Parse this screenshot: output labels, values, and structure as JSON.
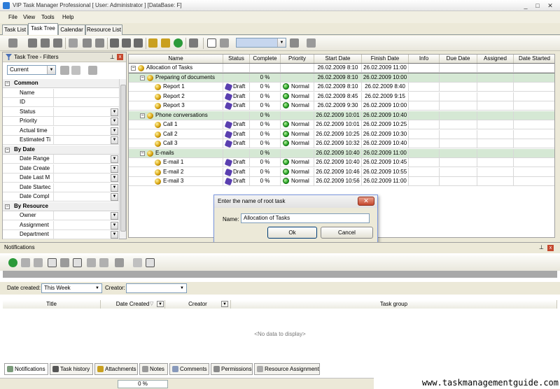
{
  "window": {
    "title": "VIP Task Manager Professional [ User: Administrator ] [DataBase: F]"
  },
  "menu": {
    "items": [
      {
        "label": "File"
      },
      {
        "label": "View"
      },
      {
        "label": "Tools"
      },
      {
        "label": "Help"
      }
    ]
  },
  "tabs": [
    {
      "label": "Task List"
    },
    {
      "label": "Task Tree"
    },
    {
      "label": "Calendar"
    },
    {
      "label": "Resource List"
    }
  ],
  "filter_panel": {
    "title": "Task Tree - Filters",
    "view_select": "Current",
    "categories": [
      {
        "label": "Common",
        "rows": [
          {
            "label": "Name",
            "has_dropdown": false
          },
          {
            "label": "ID",
            "has_dropdown": false
          },
          {
            "label": "Status",
            "has_dropdown": true
          },
          {
            "label": "Priority",
            "has_dropdown": true
          },
          {
            "label": "Actual time",
            "has_dropdown": true
          },
          {
            "label": "Estimated Ti",
            "has_dropdown": true
          }
        ]
      },
      {
        "label": "By Date",
        "rows": [
          {
            "label": "Date Range",
            "has_dropdown": true
          },
          {
            "label": "Date Create",
            "has_dropdown": true
          },
          {
            "label": "Date Last M",
            "has_dropdown": true
          },
          {
            "label": "Date Startec",
            "has_dropdown": true
          },
          {
            "label": "Date Compl",
            "has_dropdown": true
          }
        ]
      },
      {
        "label": "By Resource",
        "rows": [
          {
            "label": "Owner",
            "has_dropdown": true
          },
          {
            "label": "Assignment",
            "has_dropdown": true
          },
          {
            "label": "Department",
            "has_dropdown": true
          }
        ]
      }
    ]
  },
  "grid": {
    "columns": [
      "Name",
      "Status",
      "Complete",
      "Priority",
      "Start Date",
      "Finish Date",
      "Info",
      "Due Date",
      "Assigned",
      "Date Started"
    ],
    "rows": [
      {
        "level": 0,
        "group": true,
        "selected": true,
        "name": "Allocation of Tasks",
        "status": "",
        "complete": "",
        "priority": "",
        "start": "26.02.2009 8:10",
        "finish": "26.02.2009 11:00"
      },
      {
        "level": 1,
        "group": true,
        "name": "Preparing of documents",
        "status": "",
        "complete": "0 %",
        "priority": "",
        "start": "26.02.2009 8:10",
        "finish": "26.02.2009 10:00"
      },
      {
        "level": 2,
        "group": false,
        "name": "Report 1",
        "status": "Draft",
        "complete": "0 %",
        "priority": "Normal",
        "start": "26.02.2009 8:10",
        "finish": "26.02.2009 8:40"
      },
      {
        "level": 2,
        "group": false,
        "name": "Report 2",
        "status": "Draft",
        "complete": "0 %",
        "priority": "Normal",
        "start": "26.02.2009 8:45",
        "finish": "26.02.2009 9:15"
      },
      {
        "level": 2,
        "group": false,
        "name": "Report 3",
        "status": "Draft",
        "complete": "0 %",
        "priority": "Normal",
        "start": "26.02.2009 9:30",
        "finish": "26.02.2009 10:00"
      },
      {
        "level": 1,
        "group": true,
        "name": "Phone conversations",
        "status": "",
        "complete": "0 %",
        "priority": "",
        "start": "26.02.2009 10:01",
        "finish": "26.02.2009 10:40"
      },
      {
        "level": 2,
        "group": false,
        "name": "Call 1",
        "status": "Draft",
        "complete": "0 %",
        "priority": "Normal",
        "start": "26.02.2009 10:01",
        "finish": "26.02.2009 10:25"
      },
      {
        "level": 2,
        "group": false,
        "name": "Call 2",
        "status": "Draft",
        "complete": "0 %",
        "priority": "Normal",
        "start": "26.02.2009 10:25",
        "finish": "26.02.2009 10:30"
      },
      {
        "level": 2,
        "group": false,
        "name": "Call 3",
        "status": "Draft",
        "complete": "0 %",
        "priority": "Normal",
        "start": "26.02.2009 10:32",
        "finish": "26.02.2009 10:40"
      },
      {
        "level": 1,
        "group": true,
        "name": "E-mails",
        "status": "",
        "complete": "0 %",
        "priority": "",
        "start": "26.02.2009 10:40",
        "finish": "26.02.2009 11:00"
      },
      {
        "level": 2,
        "group": false,
        "name": "E-mail 1",
        "status": "Draft",
        "complete": "0 %",
        "priority": "Normal",
        "start": "26.02.2009 10:40",
        "finish": "26.02.2009 10:45"
      },
      {
        "level": 2,
        "group": false,
        "name": "E-mail 2",
        "status": "Draft",
        "complete": "0 %",
        "priority": "Normal",
        "start": "26.02.2009 10:46",
        "finish": "26.02.2009 10:55"
      },
      {
        "level": 2,
        "group": false,
        "name": "E-mail 3",
        "status": "Draft",
        "complete": "0 %",
        "priority": "Normal",
        "start": "26.02.2009 10:56",
        "finish": "26.02.2009 11:00"
      }
    ]
  },
  "dialog": {
    "title": "Enter the name of root task",
    "name_label": "Name:",
    "name_value": "Allocation of Tasks",
    "ok_label": "Ok",
    "cancel_label": "Cancel"
  },
  "notifications": {
    "title": "Notifications",
    "date_created_label": "Date created:",
    "date_created_value": "This Week",
    "creator_label": "Creator:",
    "creator_value": "",
    "columns": [
      "Title",
      "Date Created",
      "Creator",
      "Task group"
    ],
    "no_data": "<No data to display>"
  },
  "bottom_tabs": [
    {
      "label": "Notifications"
    },
    {
      "label": "Task history"
    },
    {
      "label": "Attachments"
    },
    {
      "label": "Notes"
    },
    {
      "label": "Comments"
    },
    {
      "label": "Permissions"
    },
    {
      "label": "Resource Assignment"
    }
  ],
  "status": {
    "progress": "0 %"
  },
  "watermark": "www.taskmanagementguide.com",
  "colors": {
    "group_row": "#d5e8d4",
    "priority_normal": "#1b9a1b",
    "draft_icon": "#5a3fb0"
  }
}
